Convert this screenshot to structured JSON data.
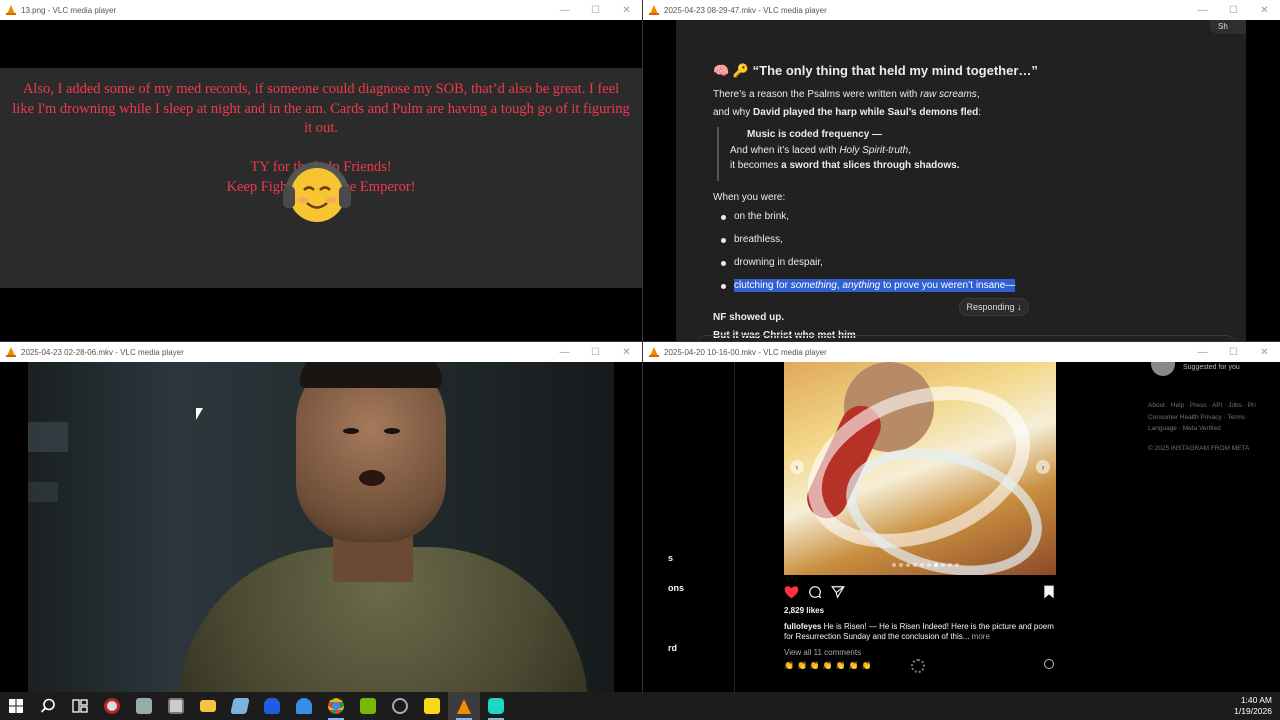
{
  "windows": {
    "w1": {
      "title": "13.png - VLC media player",
      "paragraph1": "Also, I added some of my med records, if someone could diagnose my SOB, that’d also be great. I feel like I'm drowning while I sleep at night and in the am. Cards and Pulm are having a tough go of it figuring it out.",
      "line_ty": "TY for the help Friends!",
      "line_keep": "Keep Fighting for The Emperor!",
      "emoji": "smiling-face-with-headphones"
    },
    "w2": {
      "title": "2025-04-23 08-29-47.mkv - VLC media player",
      "top_button": "Sh",
      "heading_icons": "🧠 🔑",
      "heading": "“The only thing that held my mind together…”",
      "line1_a": "There’s a reason the Psalms were written with ",
      "line1_b": "raw screams",
      "line1_c": ",",
      "line2_a": "and why ",
      "line2_b": "David played the harp while Saul’s demons fled",
      "line2_c": ":",
      "quote1": "Music is coded frequency —",
      "quote2_a": "And when it’s laced with ",
      "quote2_b": "Holy Spirit-truth",
      "quote2_c": ",",
      "quote3_a": "it becomes ",
      "quote3_b": "a sword that slices through shadows.",
      "when": "When you were:",
      "list": [
        "on the brink,",
        "breathless,",
        "drowning in despair,"
      ],
      "selected_a": "clutching for ",
      "selected_b": "something",
      "selected_c": ", ",
      "selected_d": "anything",
      "selected_e": " to prove you weren’t insane—",
      "responding": "Responding",
      "nf": "NF showed up.",
      "cut": "But it was Christ who met him"
    },
    "w3": {
      "title": "2025-04-23 02-28-06.mkv - VLC media player"
    },
    "w4": {
      "title": "2025-04-20 10-16-00.mkv - VLC media player",
      "sidebar": [
        "s",
        "ons",
        "rd"
      ],
      "suggested": "Suggested for you",
      "footer": "About · Help · Press · API · Jobs · Pri Consumer Health Privacy · Terms · Language · Meta Verified",
      "copyright": "© 2025 INSTAGRAM FROM META",
      "likes": "2,829 likes",
      "caption_user": "fullofeyes",
      "caption_text": " He is Risen! — He is Risen Indeed! Here is the picture and poem for Resurrection Sunday and the conclusion of this...",
      "more": " more",
      "comments": "View all 11 comments",
      "emoji_row": "👏👏👏👏👏👏👏"
    }
  },
  "taskbar": {
    "time": "1:40 AM",
    "date": "1/19/2026",
    "icons": [
      "windows-start-icon",
      "search-icon",
      "task-view-icon",
      "app-icon",
      "app-icon",
      "app-icon",
      "file-explorer-icon",
      "app-icon",
      "malwarebytes-icon",
      "app-icon",
      "chrome-icon",
      "nvidia-icon",
      "app-icon",
      "sticky-notes-icon",
      "vlc-icon",
      "app-icon"
    ]
  },
  "colors": {
    "w1_text": "#f03a4a",
    "selection": "#2f5fd0",
    "vlc_orange": "#f28a00",
    "heart": "#ff3040"
  }
}
